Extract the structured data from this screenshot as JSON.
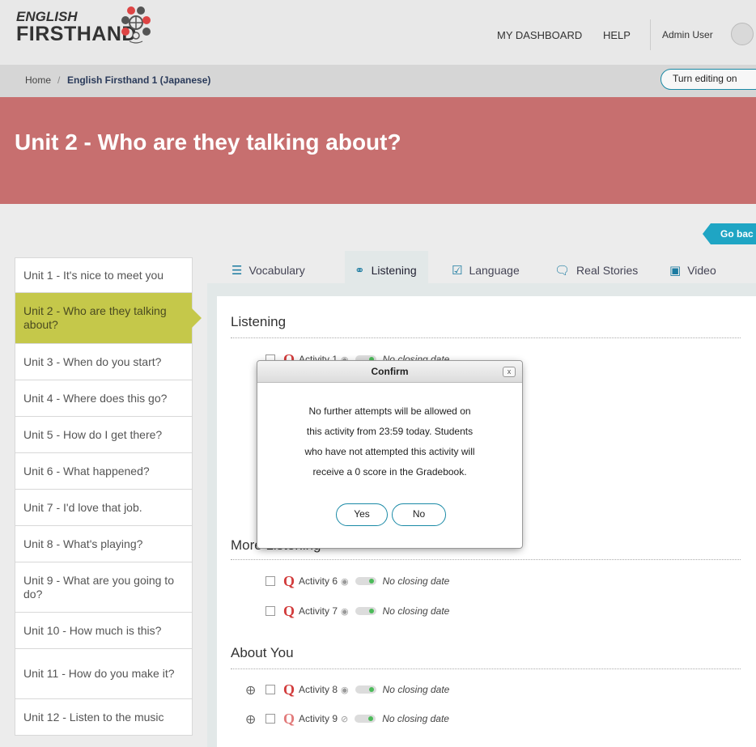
{
  "header": {
    "logo_line1": "ENGLISH",
    "logo_line2": "FIRSTHAND",
    "nav": [
      "MY DASHBOARD",
      "HELP"
    ],
    "user_name": "Admin User"
  },
  "breadcrumb": {
    "home": "Home",
    "separator": "/",
    "course": "English Firsthand 1 (Japanese)"
  },
  "edit_button": "Turn editing on",
  "banner_title": "Unit 2 - Who are they talking about?",
  "go_back": "Go bac",
  "colors": {
    "banner": "#c76f6f",
    "active_unit": "#c5c84a",
    "accent": "#1a8aa6",
    "go_back": "#1fa5c4",
    "quiz_icon": "#d23c3c",
    "status_dot": "#4cbb5a"
  },
  "sidebar": {
    "items": [
      {
        "label": "Unit 1 - It's nice to meet you",
        "active": false
      },
      {
        "label": "Unit 2 - Who are they talking about?",
        "active": true
      },
      {
        "label": "Unit 3 - When do you start?",
        "active": false
      },
      {
        "label": "Unit 4 - Where does this go?",
        "active": false
      },
      {
        "label": "Unit 5 - How do I get there?",
        "active": false
      },
      {
        "label": "Unit 6 - What happened?",
        "active": false
      },
      {
        "label": "Unit 7 - I'd love that job.",
        "active": false
      },
      {
        "label": "Unit 8 - What's playing?",
        "active": false
      },
      {
        "label": "Unit 9 - What are you going to do?",
        "active": false
      },
      {
        "label": "Unit 10 - How much is this?",
        "active": false
      },
      {
        "label": "Unit 11 - How do you make it?",
        "active": false
      },
      {
        "label": "Unit 12 - Listen to the music",
        "active": false
      }
    ]
  },
  "tabs": [
    {
      "label": "Vocabulary",
      "icon": "list-icon"
    },
    {
      "label": "Listening",
      "icon": "headphones-icon",
      "active": true
    },
    {
      "label": "Language",
      "icon": "checkbox-icon"
    },
    {
      "label": "Real Stories",
      "icon": "chat-bubbles-icon"
    },
    {
      "label": "Video",
      "icon": "video-icon"
    }
  ],
  "sections": {
    "listening": "Listening",
    "more_listening": "More Listening",
    "about_you": "About You"
  },
  "activities": {
    "a1": {
      "name": "Activity 1",
      "date": "No closing date"
    },
    "a6": {
      "name": "Activity 6",
      "date": "No closing date"
    },
    "a7": {
      "name": "Activity 7",
      "date": "No closing date"
    },
    "a8": {
      "name": "Activity 8",
      "date": "No closing date"
    },
    "a9": {
      "name": "Activity 9",
      "date": "No closing date"
    }
  },
  "dialog": {
    "title": "Confirm",
    "close": "x",
    "lines": [
      "No further attempts will be allowed on",
      "this activity from 23:59 today. Students",
      "who have not attempted this activity will",
      "receive a 0 score in the Gradebook."
    ],
    "yes": "Yes",
    "no": "No"
  }
}
